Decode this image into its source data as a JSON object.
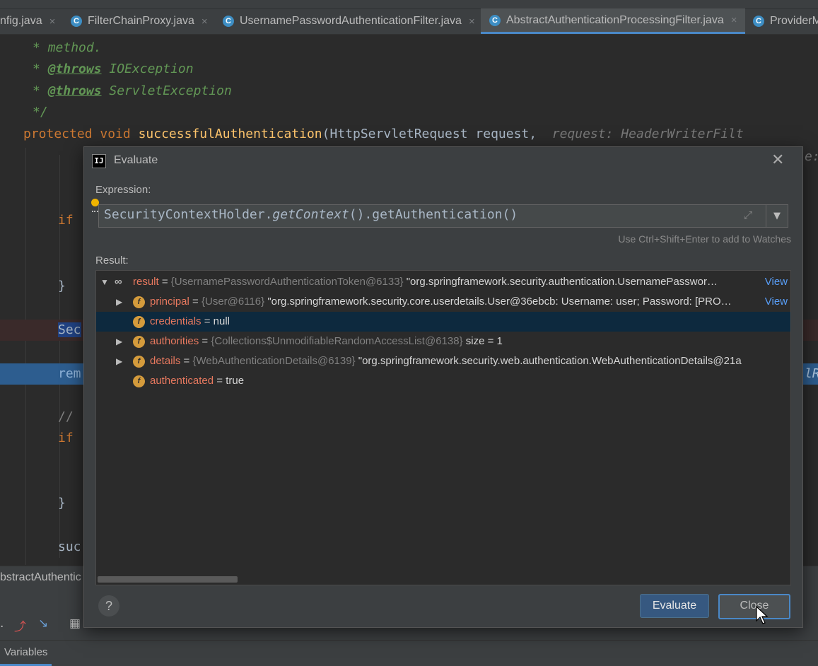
{
  "tabs": [
    {
      "label": "nfig.java",
      "active": false
    },
    {
      "label": "FilterChainProxy.java",
      "active": false
    },
    {
      "label": "UsernamePasswordAuthenticationFilter.java",
      "active": false
    },
    {
      "label": "AbstractAuthenticationProcessingFilter.java",
      "active": true
    },
    {
      "label": "ProviderM",
      "active": false
    }
  ],
  "editor": {
    "line1_star": "* ",
    "line1_text": "method.",
    "line2_star": "* ",
    "line2_tag": "@throws",
    "line2_text": " IOException",
    "line3_star": "* ",
    "line3_tag": "@throws",
    "line3_text": " ServletException",
    "line4": "*/",
    "sig_protected": "protected ",
    "sig_void": "void ",
    "sig_method": "successfulAuthentication",
    "sig_params": "(HttpServletRequest request, ",
    "sig_hint": "request: HeaderWriterFilt",
    "hint2": "e:",
    "if1": "if",
    "brace1": "}",
    "sec": "Sec",
    "rem": "rem",
    "rem_right": "lR",
    "comment": "//",
    "if2": "if",
    "brace2": "}",
    "suc": "suc"
  },
  "breadcrumb": "bstractAuthentic",
  "bottom_tabs": {
    "variables": "Variables"
  },
  "dialog": {
    "title": "Evaluate",
    "logo": "IJ",
    "expression_label": "Expression:",
    "expression": {
      "part1": "SecurityContextHolder.",
      "part2": "getContext",
      "part3": "().getAuthentication()"
    },
    "watch_hint": "Use Ctrl+Shift+Enter to add to Watches",
    "result_label": "Result:",
    "result_rows": [
      {
        "name": "result",
        "type": "{UsernamePasswordAuthenticationToken@6133}",
        "value": " \"org.springframework.security.authentication.UsernamePasswor…",
        "view": "View"
      },
      {
        "name": "principal",
        "type": "{User@6116}",
        "value": " \"org.springframework.security.core.userdetails.User@36ebcb: Username: user; Password: [PRO…",
        "view": "View"
      },
      {
        "name": "credentials",
        "type": "",
        "value": "null",
        "view": ""
      },
      {
        "name": "authorities",
        "type": "{Collections$UnmodifiableRandomAccessList@6138}",
        "value": "  size = 1",
        "view": ""
      },
      {
        "name": "details",
        "type": "{WebAuthenticationDetails@6139}",
        "value": " \"org.springframework.security.web.authentication.WebAuthenticationDetails@21a",
        "view": ""
      },
      {
        "name": "authenticated",
        "type": "",
        "value": "true",
        "view": ""
      }
    ],
    "evaluate_button": "Evaluate",
    "close_button": "Close",
    "help": "?"
  }
}
